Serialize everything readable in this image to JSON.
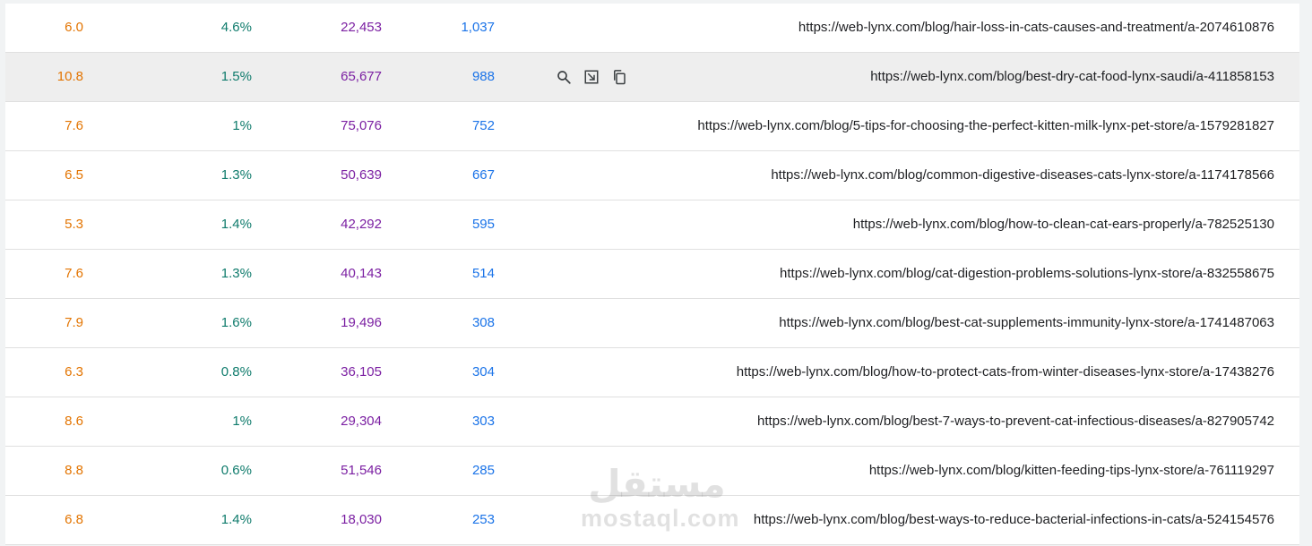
{
  "rows": [
    {
      "position": "6.0",
      "ctr": "4.6%",
      "impressions": "22,453",
      "clicks": "1,037",
      "url": "https://web-lynx.com/blog/hair-loss-in-cats-causes-and-treatment/a-2074610876"
    },
    {
      "position": "10.8",
      "ctr": "1.5%",
      "impressions": "65,677",
      "clicks": "988",
      "url": "https://web-lynx.com/blog/best-dry-cat-food-lynx-saudi/a-411858153"
    },
    {
      "position": "7.6",
      "ctr": "1%",
      "impressions": "75,076",
      "clicks": "752",
      "url": "https://web-lynx.com/blog/5-tips-for-choosing-the-perfect-kitten-milk-lynx-pet-store/a-1579281827"
    },
    {
      "position": "6.5",
      "ctr": "1.3%",
      "impressions": "50,639",
      "clicks": "667",
      "url": "https://web-lynx.com/blog/common-digestive-diseases-cats-lynx-store/a-1174178566"
    },
    {
      "position": "5.3",
      "ctr": "1.4%",
      "impressions": "42,292",
      "clicks": "595",
      "url": "https://web-lynx.com/blog/how-to-clean-cat-ears-properly/a-782525130"
    },
    {
      "position": "7.6",
      "ctr": "1.3%",
      "impressions": "40,143",
      "clicks": "514",
      "url": "https://web-lynx.com/blog/cat-digestion-problems-solutions-lynx-store/a-832558675"
    },
    {
      "position": "7.9",
      "ctr": "1.6%",
      "impressions": "19,496",
      "clicks": "308",
      "url": "https://web-lynx.com/blog/best-cat-supplements-immunity-lynx-store/a-1741487063"
    },
    {
      "position": "6.3",
      "ctr": "0.8%",
      "impressions": "36,105",
      "clicks": "304",
      "url": "https://web-lynx.com/blog/how-to-protect-cats-from-winter-diseases-lynx-store/a-17438276"
    },
    {
      "position": "8.6",
      "ctr": "1%",
      "impressions": "29,304",
      "clicks": "303",
      "url": "https://web-lynx.com/blog/best-7-ways-to-prevent-cat-infectious-diseases/a-827905742"
    },
    {
      "position": "8.8",
      "ctr": "0.6%",
      "impressions": "51,546",
      "clicks": "285",
      "url": "https://web-lynx.com/blog/kitten-feeding-tips-lynx-store/a-761119297"
    },
    {
      "position": "6.8",
      "ctr": "1.4%",
      "impressions": "18,030",
      "clicks": "253",
      "url": "https://web-lynx.com/blog/best-ways-to-reduce-bacterial-infections-in-cats/a-524154576"
    }
  ],
  "hovered_row_index": 1,
  "row_actions": [
    {
      "icon": "search-icon"
    },
    {
      "icon": "open-in-new-icon"
    },
    {
      "icon": "copy-icon"
    }
  ],
  "watermark": {
    "arabic": "مستقل",
    "latin": "mostaql.com"
  },
  "colors": {
    "position": "#e37400",
    "ctr": "#0f7b6c",
    "impressions": "#7b1fa2",
    "clicks": "#1a73e8",
    "url": "#202124",
    "hover_row": "#eeeeee"
  }
}
